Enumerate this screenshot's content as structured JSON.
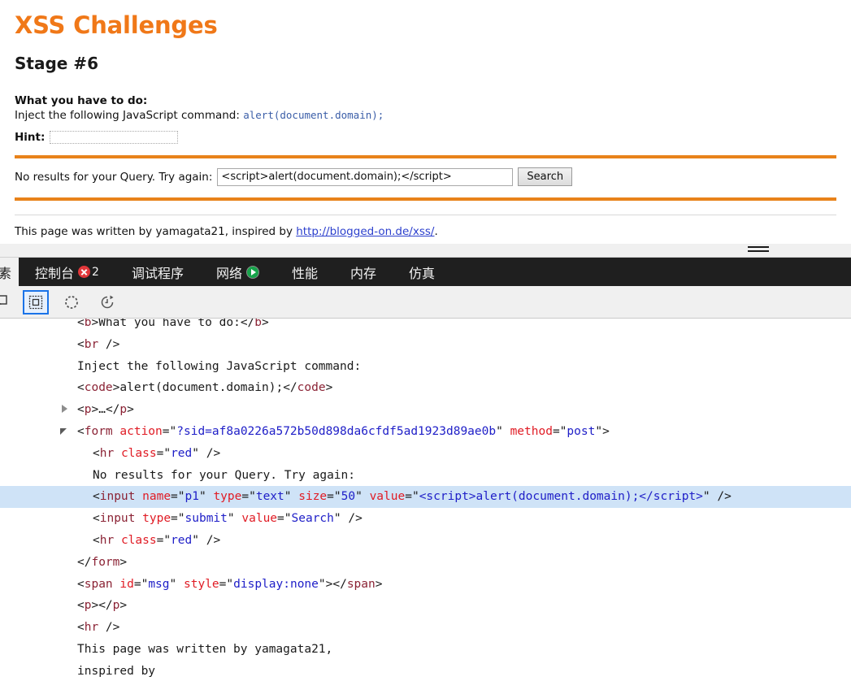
{
  "page": {
    "site_title": "XSS Challenges",
    "stage_title": "Stage #6",
    "todo_label": "What you have to do:",
    "todo_text": "Inject the following JavaScript command:",
    "todo_code": "alert(document.domain);",
    "hint_label": "Hint:",
    "hint_value": "",
    "hint_placeholder": "",
    "search_label": "No results for your Query. Try again:",
    "search_value": "<script>alert(document.domain);</script>",
    "search_placeholder": "",
    "search_button": "Search",
    "credit_prefix": "This page was written by yamagata21, inspired by ",
    "credit_link": "http://blogged-on.de/xss/",
    "credit_suffix": "."
  },
  "devtools": {
    "tabs": [
      {
        "label": "元素",
        "active": true,
        "badge": null,
        "icon": null
      },
      {
        "label": "控制台",
        "active": false,
        "badge": "2",
        "icon": "error-badge-icon"
      },
      {
        "label": "调试程序",
        "active": false,
        "badge": null,
        "icon": null
      },
      {
        "label": "网络",
        "active": false,
        "badge": null,
        "icon": "play-circle-icon"
      },
      {
        "label": "性能",
        "active": false,
        "badge": null,
        "icon": null
      },
      {
        "label": "内存",
        "active": false,
        "badge": null,
        "icon": null
      },
      {
        "label": "仿真",
        "active": false,
        "badge": null,
        "icon": null
      }
    ],
    "toolbar": [
      {
        "icon": "element-picker-icon",
        "selected": false
      },
      {
        "icon": "box-model-icon",
        "selected": true
      },
      {
        "icon": "dashed-circle-icon",
        "selected": false
      },
      {
        "icon": "reload-clock-icon",
        "selected": false
      }
    ],
    "splitter": "resize-grip",
    "dom_lines": [
      {
        "indent": 1,
        "twisty": null,
        "selected": false,
        "partial_top": true,
        "parts": [
          {
            "t": "punct",
            "s": "<"
          },
          {
            "t": "tag",
            "s": "b"
          },
          {
            "t": "punct",
            "s": ">"
          },
          {
            "t": "txt",
            "s": "What you have to do:"
          },
          {
            "t": "punct",
            "s": "</"
          },
          {
            "t": "tag",
            "s": "b"
          },
          {
            "t": "punct",
            "s": ">"
          }
        ]
      },
      {
        "indent": 1,
        "twisty": null,
        "selected": false,
        "parts": [
          {
            "t": "punct",
            "s": "<"
          },
          {
            "t": "tag",
            "s": "br"
          },
          {
            "t": "punct",
            "s": " />"
          }
        ]
      },
      {
        "indent": 1,
        "twisty": null,
        "selected": false,
        "parts": [
          {
            "t": "txt",
            "s": "Inject the following JavaScript command:"
          }
        ]
      },
      {
        "indent": 1,
        "twisty": null,
        "selected": false,
        "parts": [
          {
            "t": "punct",
            "s": "<"
          },
          {
            "t": "tag",
            "s": "code"
          },
          {
            "t": "punct",
            "s": ">"
          },
          {
            "t": "txt",
            "s": "alert(document.domain);"
          },
          {
            "t": "punct",
            "s": "</"
          },
          {
            "t": "tag",
            "s": "code"
          },
          {
            "t": "punct",
            "s": ">"
          }
        ]
      },
      {
        "indent": 1,
        "twisty": "closed",
        "selected": false,
        "parts": [
          {
            "t": "punct",
            "s": "<"
          },
          {
            "t": "tag",
            "s": "p"
          },
          {
            "t": "punct",
            "s": ">"
          },
          {
            "t": "txt",
            "s": "…"
          },
          {
            "t": "punct",
            "s": "</"
          },
          {
            "t": "tag",
            "s": "p"
          },
          {
            "t": "punct",
            "s": ">"
          }
        ]
      },
      {
        "indent": 1,
        "twisty": "open",
        "selected": false,
        "parts": [
          {
            "t": "punct",
            "s": "<"
          },
          {
            "t": "tag",
            "s": "form"
          },
          {
            "t": "txt",
            "s": " "
          },
          {
            "t": "attr",
            "s": "action"
          },
          {
            "t": "punct",
            "s": "=\""
          },
          {
            "t": "val",
            "s": "?sid=af8a0226a572b50d898da6cfdf5ad1923d89ae0b"
          },
          {
            "t": "punct",
            "s": "\""
          },
          {
            "t": "txt",
            "s": " "
          },
          {
            "t": "attr",
            "s": "method"
          },
          {
            "t": "punct",
            "s": "=\""
          },
          {
            "t": "val",
            "s": "post"
          },
          {
            "t": "punct",
            "s": "\">"
          }
        ]
      },
      {
        "indent": 2,
        "twisty": null,
        "selected": false,
        "parts": [
          {
            "t": "punct",
            "s": "<"
          },
          {
            "t": "tag",
            "s": "hr"
          },
          {
            "t": "txt",
            "s": " "
          },
          {
            "t": "attr",
            "s": "class"
          },
          {
            "t": "punct",
            "s": "=\""
          },
          {
            "t": "val",
            "s": "red"
          },
          {
            "t": "punct",
            "s": "\" />"
          }
        ]
      },
      {
        "indent": 2,
        "twisty": null,
        "selected": false,
        "parts": [
          {
            "t": "txt",
            "s": "No results for your Query. Try again:"
          }
        ]
      },
      {
        "indent": 2,
        "twisty": null,
        "selected": true,
        "parts": [
          {
            "t": "punct",
            "s": "<"
          },
          {
            "t": "tag",
            "s": "input"
          },
          {
            "t": "txt",
            "s": " "
          },
          {
            "t": "attr",
            "s": "name"
          },
          {
            "t": "punct",
            "s": "=\""
          },
          {
            "t": "val",
            "s": "p1"
          },
          {
            "t": "punct",
            "s": "\""
          },
          {
            "t": "txt",
            "s": " "
          },
          {
            "t": "attr",
            "s": "type"
          },
          {
            "t": "punct",
            "s": "=\""
          },
          {
            "t": "val",
            "s": "text"
          },
          {
            "t": "punct",
            "s": "\""
          },
          {
            "t": "txt",
            "s": " "
          },
          {
            "t": "attr",
            "s": "size"
          },
          {
            "t": "punct",
            "s": "=\""
          },
          {
            "t": "val",
            "s": "50"
          },
          {
            "t": "punct",
            "s": "\""
          },
          {
            "t": "txt",
            "s": " "
          },
          {
            "t": "attr",
            "s": "value"
          },
          {
            "t": "punct",
            "s": "=\""
          },
          {
            "t": "val",
            "s": "<script>alert(document.domain);</script>"
          },
          {
            "t": "punct",
            "s": "\" />"
          }
        ]
      },
      {
        "indent": 2,
        "twisty": null,
        "selected": false,
        "parts": [
          {
            "t": "punct",
            "s": "<"
          },
          {
            "t": "tag",
            "s": "input"
          },
          {
            "t": "txt",
            "s": " "
          },
          {
            "t": "attr",
            "s": "type"
          },
          {
            "t": "punct",
            "s": "=\""
          },
          {
            "t": "val",
            "s": "submit"
          },
          {
            "t": "punct",
            "s": "\""
          },
          {
            "t": "txt",
            "s": " "
          },
          {
            "t": "attr",
            "s": "value"
          },
          {
            "t": "punct",
            "s": "=\""
          },
          {
            "t": "val",
            "s": "Search"
          },
          {
            "t": "punct",
            "s": "\" />"
          }
        ]
      },
      {
        "indent": 2,
        "twisty": null,
        "selected": false,
        "parts": [
          {
            "t": "punct",
            "s": "<"
          },
          {
            "t": "tag",
            "s": "hr"
          },
          {
            "t": "txt",
            "s": " "
          },
          {
            "t": "attr",
            "s": "class"
          },
          {
            "t": "punct",
            "s": "=\""
          },
          {
            "t": "val",
            "s": "red"
          },
          {
            "t": "punct",
            "s": "\" />"
          }
        ]
      },
      {
        "indent": 1,
        "twisty": null,
        "selected": false,
        "parts": [
          {
            "t": "punct",
            "s": "</"
          },
          {
            "t": "tag",
            "s": "form"
          },
          {
            "t": "punct",
            "s": ">"
          }
        ]
      },
      {
        "indent": 1,
        "twisty": null,
        "selected": false,
        "parts": [
          {
            "t": "punct",
            "s": "<"
          },
          {
            "t": "tag",
            "s": "span"
          },
          {
            "t": "txt",
            "s": " "
          },
          {
            "t": "attr",
            "s": "id"
          },
          {
            "t": "punct",
            "s": "=\""
          },
          {
            "t": "val",
            "s": "msg"
          },
          {
            "t": "punct",
            "s": "\""
          },
          {
            "t": "txt",
            "s": " "
          },
          {
            "t": "attr",
            "s": "style"
          },
          {
            "t": "punct",
            "s": "=\""
          },
          {
            "t": "val",
            "s": "display:none"
          },
          {
            "t": "punct",
            "s": "\">"
          },
          {
            "t": "punct",
            "s": "</"
          },
          {
            "t": "tag",
            "s": "span"
          },
          {
            "t": "punct",
            "s": ">"
          }
        ]
      },
      {
        "indent": 1,
        "twisty": null,
        "selected": false,
        "parts": [
          {
            "t": "punct",
            "s": "<"
          },
          {
            "t": "tag",
            "s": "p"
          },
          {
            "t": "punct",
            "s": ">"
          },
          {
            "t": "punct",
            "s": "</"
          },
          {
            "t": "tag",
            "s": "p"
          },
          {
            "t": "punct",
            "s": ">"
          }
        ]
      },
      {
        "indent": 1,
        "twisty": null,
        "selected": false,
        "parts": [
          {
            "t": "punct",
            "s": "<"
          },
          {
            "t": "tag",
            "s": "hr"
          },
          {
            "t": "punct",
            "s": " />"
          }
        ]
      },
      {
        "indent": 1,
        "twisty": null,
        "selected": false,
        "parts": [
          {
            "t": "txt",
            "s": "This page was written by yamagata21,"
          }
        ]
      },
      {
        "indent": 1,
        "twisty": null,
        "selected": false,
        "parts": [
          {
            "t": "txt",
            "s": "inspired by"
          }
        ]
      }
    ]
  },
  "colors": {
    "brand_orange": "#f07818",
    "rule_orange": "#e8821a",
    "tab_bar_bg": "#1f1f1f",
    "selection_blue": "#cfe3f7",
    "tag_maroon": "#8b2335",
    "attr_red": "#e01b24",
    "value_blue": "#2020c8",
    "error_red": "#e2373a",
    "network_green": "#16a34a",
    "picker_blue": "#1a73e8"
  }
}
